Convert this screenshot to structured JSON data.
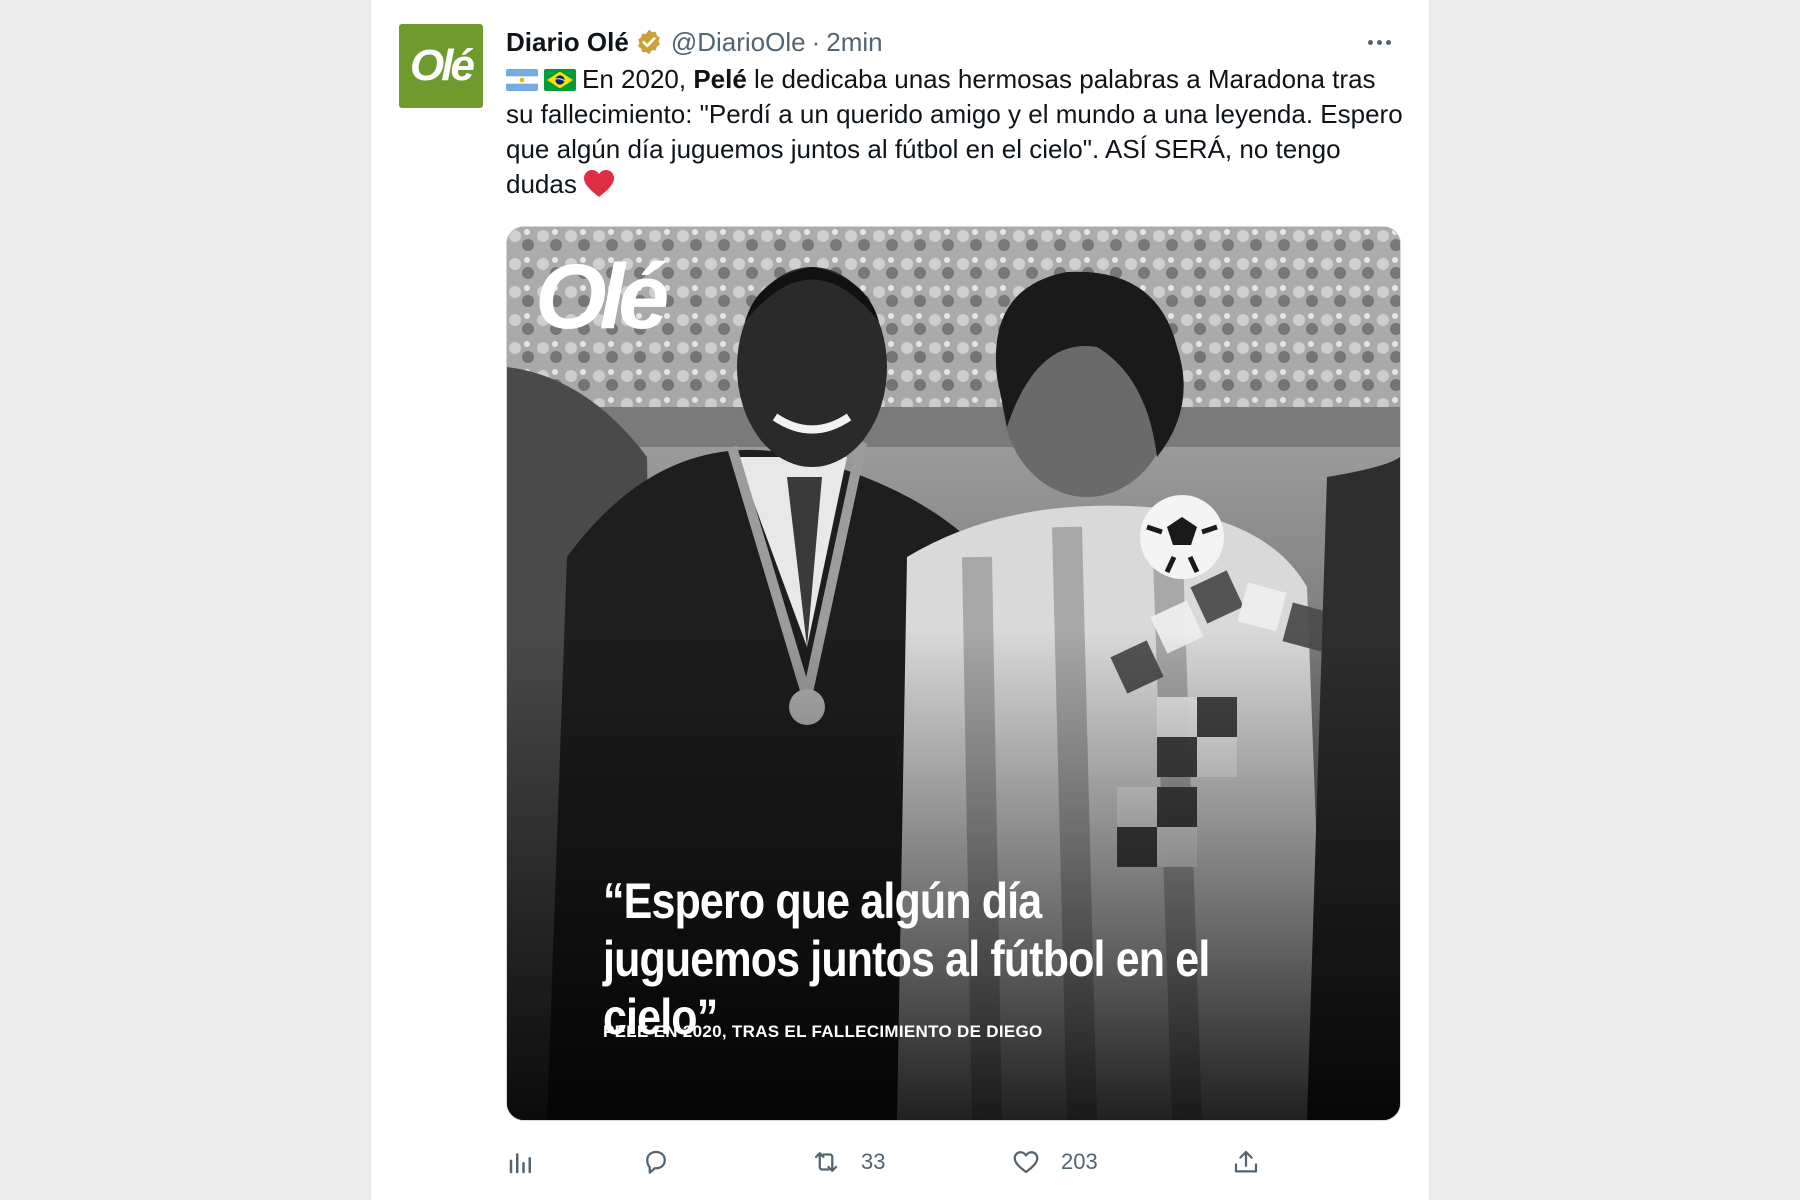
{
  "tweet": {
    "author": {
      "display_name": "Diario Olé",
      "handle": "@DiarioOle",
      "separator": "·",
      "timestamp": "2min",
      "avatar_logo": "Olé",
      "verified_color": "#c9a23c"
    },
    "text": {
      "line_prefix": "En 2020, ",
      "bold": "Pelé",
      "rest": " le dedicaba unas hermosas palabras a Maradona tras su fallecimiento: \"Perdí a un querido amigo y el mundo a una leyenda. Espero que algún día juguemos juntos al fútbol en el cielo\". ASÍ SERÁ, no tengo dudas"
    },
    "emojis": [
      "argentina-flag",
      "brazil-flag",
      "red-heart"
    ],
    "media": {
      "logo": "Olé",
      "quote": "“Espero que algún día juguemos juntos al fútbol en el cielo”",
      "caption": "PELÉ EN 2020, TRAS EL FALLECIMIENTO DE DIEGO"
    },
    "actions": {
      "views_icon": "bar-chart-icon",
      "reply_icon": "reply-icon",
      "retweet_icon": "retweet-icon",
      "retweet_count": "33",
      "like_icon": "heart-icon",
      "like_count": "203",
      "share_icon": "share-icon"
    }
  },
  "colors": {
    "avatar_bg": "#6f9a2d",
    "secondary_text": "#536471",
    "primary_text": "#0f1419"
  }
}
